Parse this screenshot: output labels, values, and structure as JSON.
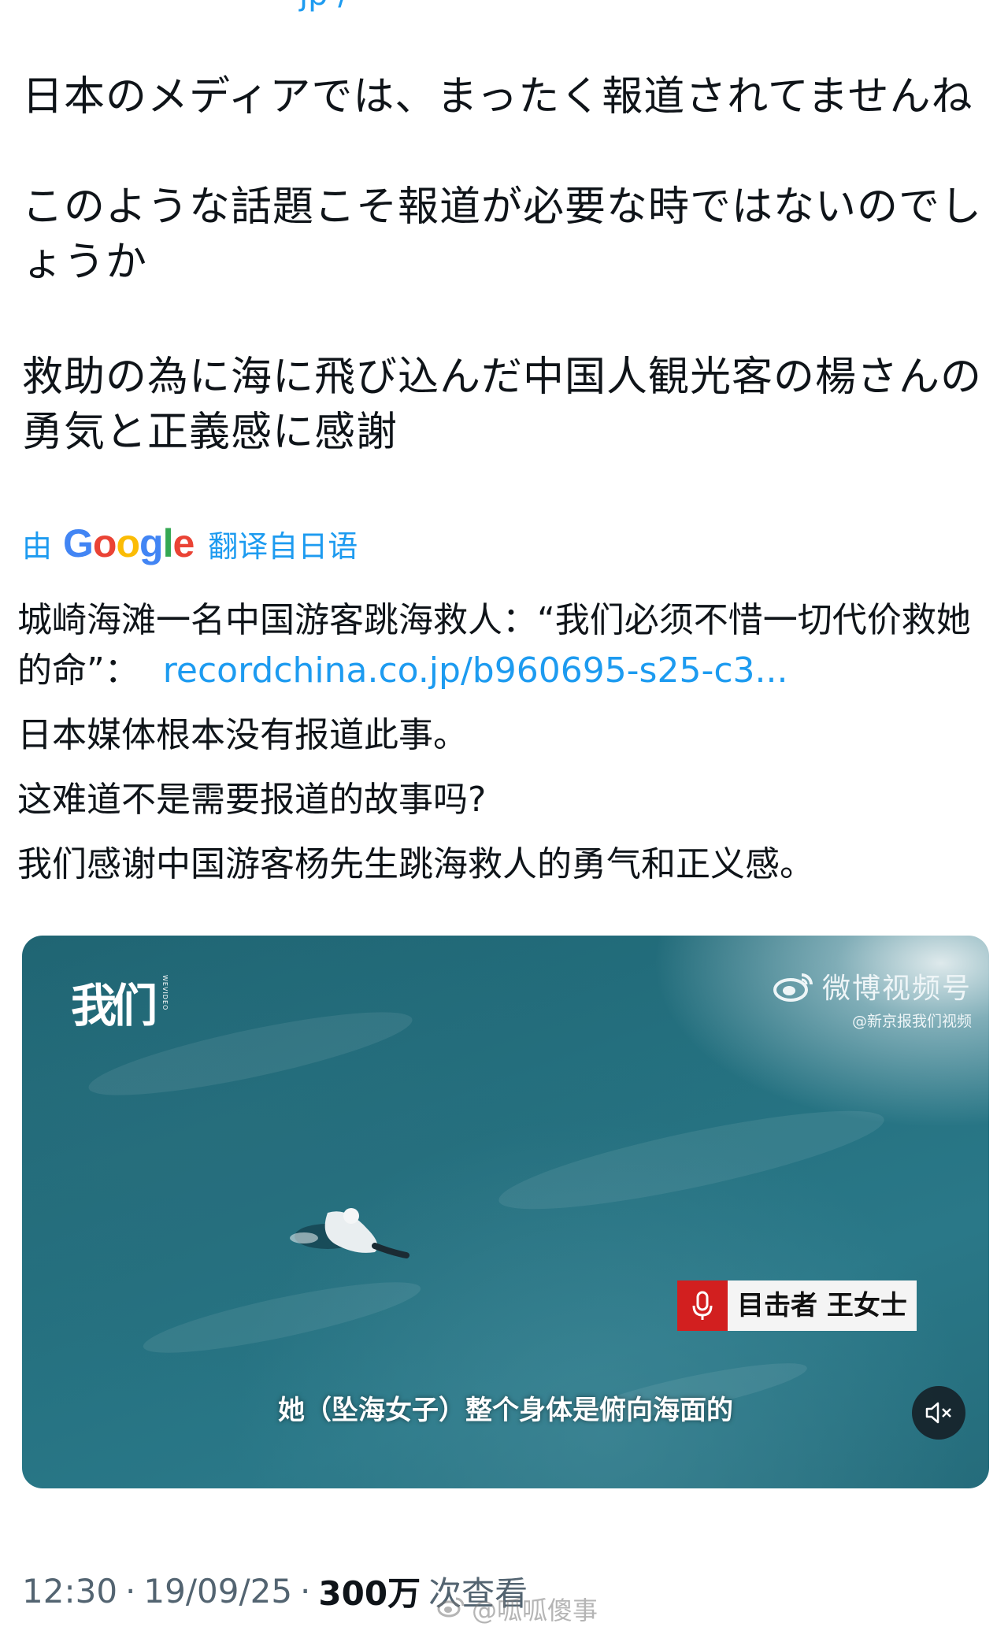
{
  "tweet": {
    "handle_fragment": "jp /",
    "original_paragraphs": [
      "日本のメディアでは、まったく報道されてませんね",
      "このような話題こそ報道が必要な時ではないのでしょうか",
      "救助の為に海に飛び込んだ中国人観光客の楊さんの勇気と正義感に感謝"
    ],
    "translation": {
      "prefix": "由",
      "brand": "Google",
      "suffix": "翻译自日语"
    },
    "translated": {
      "line1_text": "城崎海滩一名中国游客跳海救人：“我们必须不惜一切代价救她的命”：",
      "line1_link": "recordchina.co.jp/b960695-s25-c3...",
      "line2": "日本媒体根本没有报道此事。",
      "line3": "这难道不是需要报道的故事吗?",
      "line4": "我们感谢中国游客杨先生跳海救人的勇气和正义感。"
    },
    "video": {
      "logo_text": "我们",
      "logo_sub": "WEVIDEO",
      "brand_name": "微博视频号",
      "brand_handle": "@新京报我们视频",
      "witness_label": "目击者 王女士",
      "subtitle": "她（坠海女子）整个身体是俯向海面的",
      "icons": [
        "mic-icon",
        "mute-icon",
        "weibo-icon"
      ]
    },
    "meta": {
      "time": "12:30",
      "date": "19/09/25",
      "views_count": "300万",
      "views_label": "次查看"
    },
    "watermark": "@呱呱傻事"
  },
  "colors": {
    "link": "#1d9bf0",
    "text": "#0f1419",
    "muted": "#536471",
    "witness_red": "#d21f1f"
  }
}
